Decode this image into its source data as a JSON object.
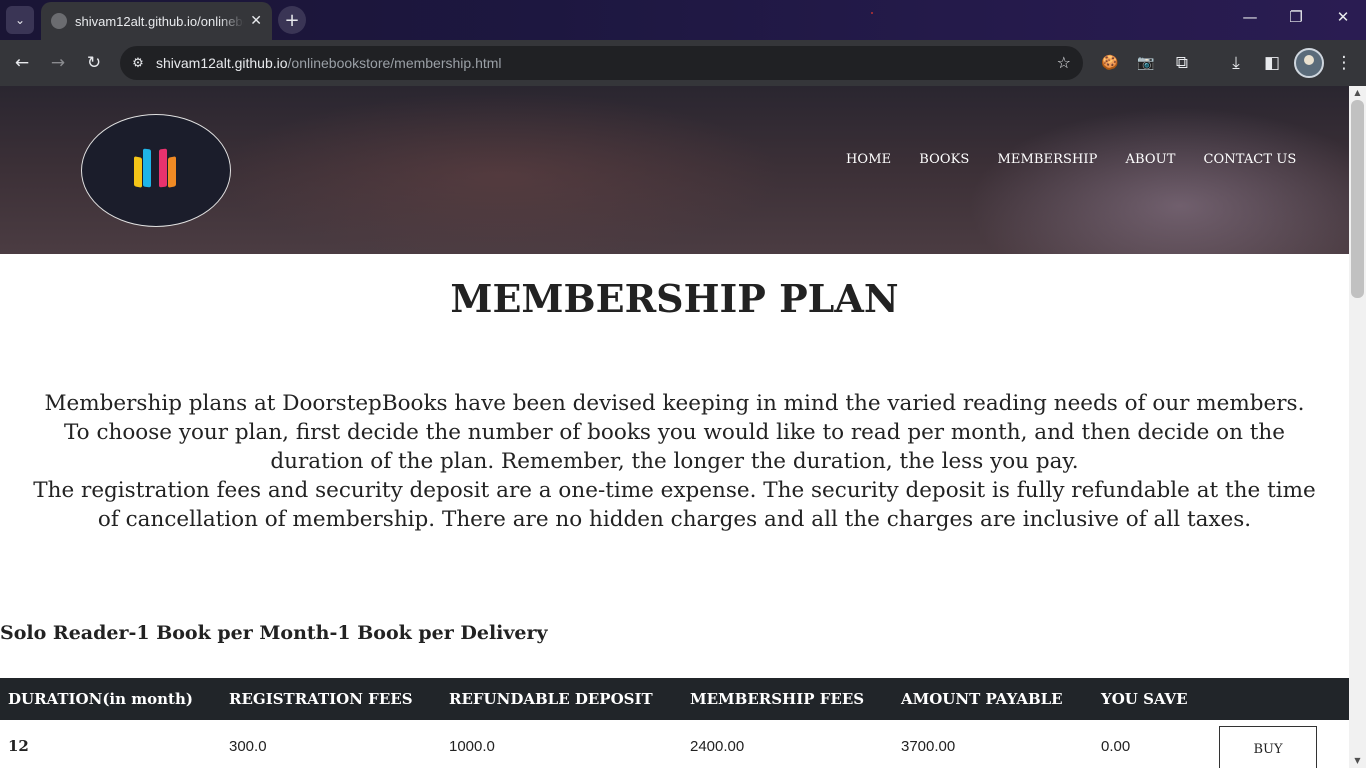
{
  "browser": {
    "tab_title": "shivam12alt.github.io/onlinebookstore/membership.html",
    "url_host": "shivam12alt.github.io",
    "url_path": "/onlinebookstore/membership.html",
    "icons": {
      "tab_dropdown": "⌄",
      "tab_close": "✕",
      "new_tab": "+",
      "minimize": "—",
      "restore": "❐",
      "close": "✕",
      "back": "←",
      "forward": "→",
      "reload": "↻",
      "site_info": "⚙",
      "bookmark": "☆",
      "extension_cookie": "🍪",
      "extension_camera": "📷",
      "extensions": "⧉",
      "download": "⤓",
      "side_panel": "◧",
      "menu": "⋮"
    }
  },
  "site": {
    "nav": [
      "HOME",
      "BOOKS",
      "MEMBERSHIP",
      "ABOUT",
      "CONTACT US"
    ],
    "logo_colors": [
      "#f5c518",
      "#1fb5e8",
      "#e8326e",
      "#f08a24"
    ]
  },
  "page": {
    "title": "MEMBERSHIP PLAN",
    "intro_lines": [
      "Membership plans at DoorstepBooks have been devised keeping in mind the varied reading needs of our members.",
      "To choose your plan, first decide the number of books you would like to read per month, and then decide on the",
      "duration of the plan. Remember, the longer the duration, the less you pay.",
      "The registration fees and security deposit are a one-time expense. The security deposit is fully refundable at the time",
      "of cancellation of membership. There are no hidden charges and all the charges are inclusive of all taxes."
    ],
    "plan_heading": "Solo Reader-1 Book per Month-1 Book per Delivery",
    "table": {
      "headers": [
        "DURATION(in month)",
        "REGISTRATION FEES",
        "REFUNDABLE DEPOSIT",
        "MEMBERSHIP FEES",
        "AMOUNT PAYABLE",
        "YOU SAVE"
      ],
      "rows": [
        [
          "12",
          "300.0",
          "1000.0",
          "2400.00",
          "3700.00",
          "0.00"
        ]
      ],
      "buy_label": "BUY"
    }
  }
}
